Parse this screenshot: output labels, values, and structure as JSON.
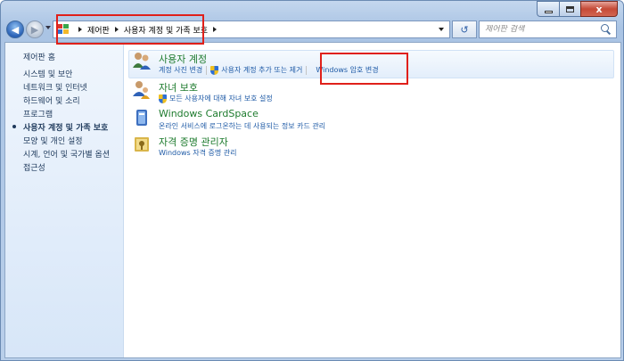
{
  "window": {
    "caption": {
      "minimize": "",
      "maximize": "",
      "close": "x"
    }
  },
  "address_bar": {
    "crumbs": [
      "제어판",
      "사용자 계정 및 가족 보호"
    ],
    "search_placeholder": "제어판 검색"
  },
  "sidebar": {
    "home": "제어판 홈",
    "items": [
      {
        "label": "시스템 및 보안",
        "active": false
      },
      {
        "label": "네트워크 및 인터넷",
        "active": false
      },
      {
        "label": "하드웨어 및 소리",
        "active": false
      },
      {
        "label": "프로그램",
        "active": false
      },
      {
        "label": "사용자 계정 및 가족 보호",
        "active": true
      },
      {
        "label": "모양 및 개인 설정",
        "active": false
      },
      {
        "label": "시계, 언어 및 국가별 옵션",
        "active": false
      },
      {
        "label": "접근성",
        "active": false
      }
    ]
  },
  "categories": [
    {
      "title": "사용자 계정",
      "links": [
        "계정 사진 변경",
        "사용자 계정 추가 또는 제거",
        "Windows 암호 변경"
      ],
      "icon": "users-icon"
    },
    {
      "title": "자녀 보호",
      "links": [
        "모든 사용자에 대해 자녀 보호 설정"
      ],
      "icon": "parental-controls-icon"
    },
    {
      "title": "Windows CardSpace",
      "links": [
        "온라인 서비스에 로그온하는 데 사용되는 정보 카드 관리"
      ],
      "icon": "cardspace-icon"
    },
    {
      "title": "자격 증명 관리자",
      "links": [
        "Windows 자격 증명 관리"
      ],
      "icon": "credential-manager-icon"
    }
  ],
  "colors": {
    "category_title": "#1e7b2e",
    "link": "#1e5aa6",
    "highlight": "#e0201a",
    "sidebar_text": "#1e395b"
  }
}
